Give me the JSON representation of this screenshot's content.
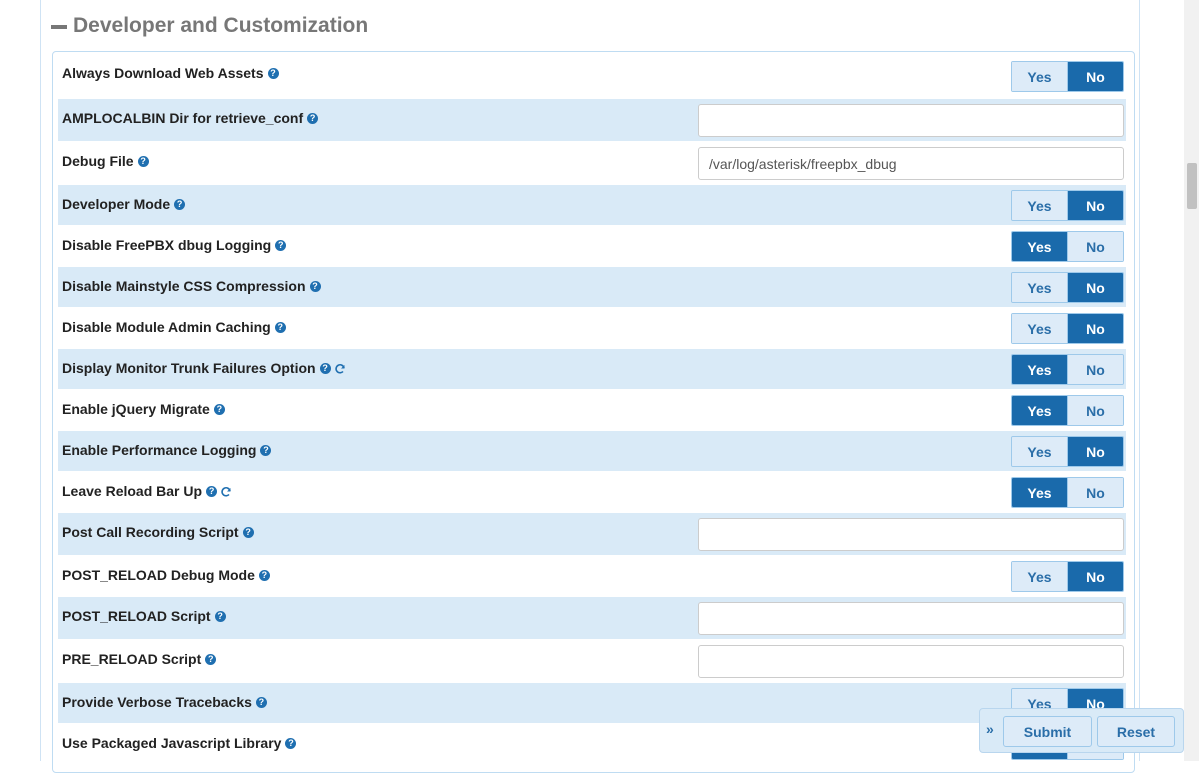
{
  "section": {
    "title": "Developer and Customization"
  },
  "rows": [
    {
      "label": "Always Download Web Assets",
      "type": "toggle",
      "value": "No",
      "reload": false
    },
    {
      "label": "AMPLOCALBIN Dir for retrieve_conf",
      "type": "text",
      "value": "",
      "reload": false
    },
    {
      "label": "Debug File",
      "type": "text",
      "value": "/var/log/asterisk/freepbx_dbug",
      "reload": false
    },
    {
      "label": "Developer Mode",
      "type": "toggle",
      "value": "No",
      "reload": false
    },
    {
      "label": "Disable FreePBX dbug Logging",
      "type": "toggle",
      "value": "Yes",
      "reload": false
    },
    {
      "label": "Disable Mainstyle CSS Compression",
      "type": "toggle",
      "value": "No",
      "reload": false
    },
    {
      "label": "Disable Module Admin Caching",
      "type": "toggle",
      "value": "No",
      "reload": false
    },
    {
      "label": "Display Monitor Trunk Failures Option",
      "type": "toggle",
      "value": "Yes",
      "reload": true
    },
    {
      "label": "Enable jQuery Migrate",
      "type": "toggle",
      "value": "Yes",
      "reload": false
    },
    {
      "label": "Enable Performance Logging",
      "type": "toggle",
      "value": "No",
      "reload": false
    },
    {
      "label": "Leave Reload Bar Up",
      "type": "toggle",
      "value": "Yes",
      "reload": true
    },
    {
      "label": "Post Call Recording Script",
      "type": "text",
      "value": "",
      "reload": false
    },
    {
      "label": "POST_RELOAD Debug Mode",
      "type": "toggle",
      "value": "No",
      "reload": false
    },
    {
      "label": "POST_RELOAD Script",
      "type": "text",
      "value": "",
      "reload": false
    },
    {
      "label": "PRE_RELOAD Script",
      "type": "text",
      "value": "",
      "reload": false
    },
    {
      "label": "Provide Verbose Tracebacks",
      "type": "toggle",
      "value": "No",
      "reload": false
    },
    {
      "label": "Use Packaged Javascript Library",
      "type": "toggle",
      "value": "Yes",
      "reload": false
    }
  ],
  "toggle_labels": {
    "yes": "Yes",
    "no": "No"
  },
  "actions": {
    "submit": "Submit",
    "reset": "Reset",
    "chevron": "»"
  },
  "icons": {
    "help": "question-circle-icon",
    "reload": "refresh-icon"
  },
  "colors": {
    "accent": "#1a6aab",
    "row_alt": "#d9eaf7",
    "title": "#777777"
  }
}
